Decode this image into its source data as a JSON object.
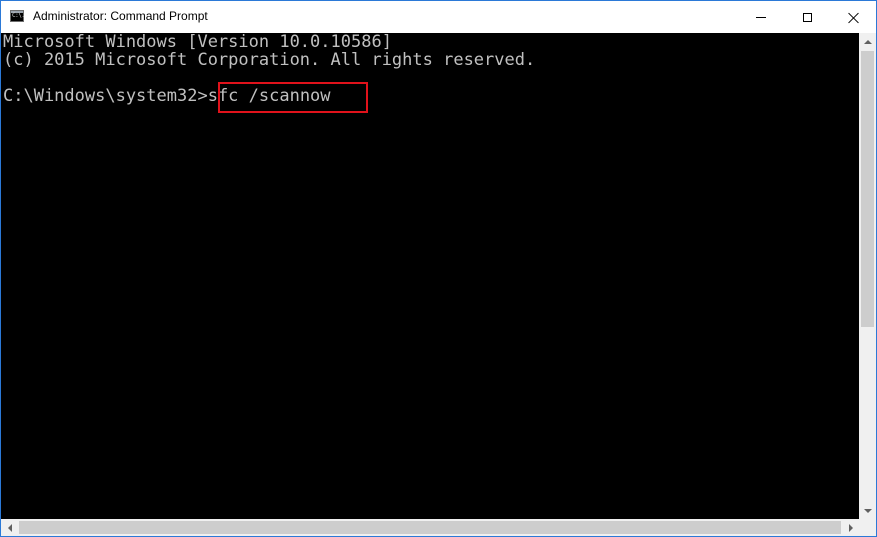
{
  "window": {
    "title": "Administrator: Command Prompt",
    "icon": "cmd-icon",
    "icon_glyph": "C:\\.",
    "accent_color": "#2b79d7"
  },
  "console": {
    "lines": [
      "Microsoft Windows [Version 10.0.10586]",
      "(c) 2015 Microsoft Corporation. All rights reserved."
    ],
    "prompt": "C:\\Windows\\system32>",
    "command": "sfc /scannow",
    "text_color": "#c0c0c0",
    "background_color": "#000000",
    "highlight_color": "#e0121b"
  },
  "controls": {
    "minimize_icon": "minimize-icon",
    "maximize_icon": "maximize-icon",
    "close_icon": "close-icon"
  }
}
